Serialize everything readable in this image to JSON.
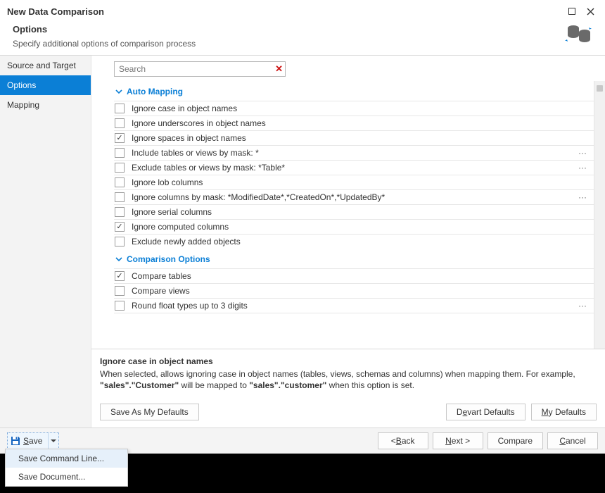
{
  "titlebar": {
    "title": "New Data Comparison"
  },
  "header": {
    "title": "Options",
    "desc": "Specify additional options of comparison process"
  },
  "sidebar": {
    "items": [
      {
        "label": "Source and Target"
      },
      {
        "label": "Options"
      },
      {
        "label": "Mapping"
      }
    ]
  },
  "search": {
    "placeholder": "Search"
  },
  "groups": [
    {
      "title": "Auto Mapping",
      "items": [
        {
          "label": "Ignore case in object names",
          "checked": false
        },
        {
          "label": "Ignore underscores in object names",
          "checked": false
        },
        {
          "label": "Ignore spaces in object names",
          "checked": true
        },
        {
          "label": "Include tables or views by mask: *",
          "checked": false,
          "editable": true
        },
        {
          "label": "Exclude tables or views by mask: *Table*",
          "checked": false,
          "editable": true
        },
        {
          "label": "Ignore lob columns",
          "checked": false
        },
        {
          "label": "Ignore columns by mask: *ModifiedDate*,*CreatedOn*,*UpdatedBy*",
          "checked": false,
          "editable": true
        },
        {
          "label": "Ignore serial columns",
          "checked": false
        },
        {
          "label": "Ignore computed columns",
          "checked": true
        },
        {
          "label": "Exclude newly added objects",
          "checked": false
        }
      ]
    },
    {
      "title": "Comparison Options",
      "items": [
        {
          "label": "Compare tables",
          "checked": true
        },
        {
          "label": "Compare views",
          "checked": false
        },
        {
          "label": "Round float types up to 3 digits",
          "checked": false,
          "editable": true
        }
      ]
    }
  ],
  "description": {
    "title": "Ignore case in object names",
    "body_pre": "When selected, allows ignoring case in object names (tables, views, schemas and columns) when mapping them. For example, ",
    "example1": "\"sales\".\"Customer\"",
    "body_mid": " will be mapped to ",
    "example2": "\"sales\".\"customer\"",
    "body_post": " when this option is set."
  },
  "midButtons": {
    "saveAsDefaults": "Save As My Defaults",
    "devartDefaults_pre": "D",
    "devartDefaults_u": "e",
    "devartDefaults_post": "vart Defaults",
    "myDefaults_pre": "",
    "myDefaults_u": "M",
    "myDefaults_post": "y Defaults"
  },
  "footer": {
    "save_u": "S",
    "save_post": "ave",
    "back_pre": "< ",
    "back_u": "B",
    "back_post": "ack",
    "next_u": "N",
    "next_post": "ext >",
    "compare": "Compare",
    "cancel_u": "C",
    "cancel_post": "ancel"
  },
  "saveMenu": {
    "cmdline": "Save Command Line...",
    "doc": "Save Document..."
  }
}
